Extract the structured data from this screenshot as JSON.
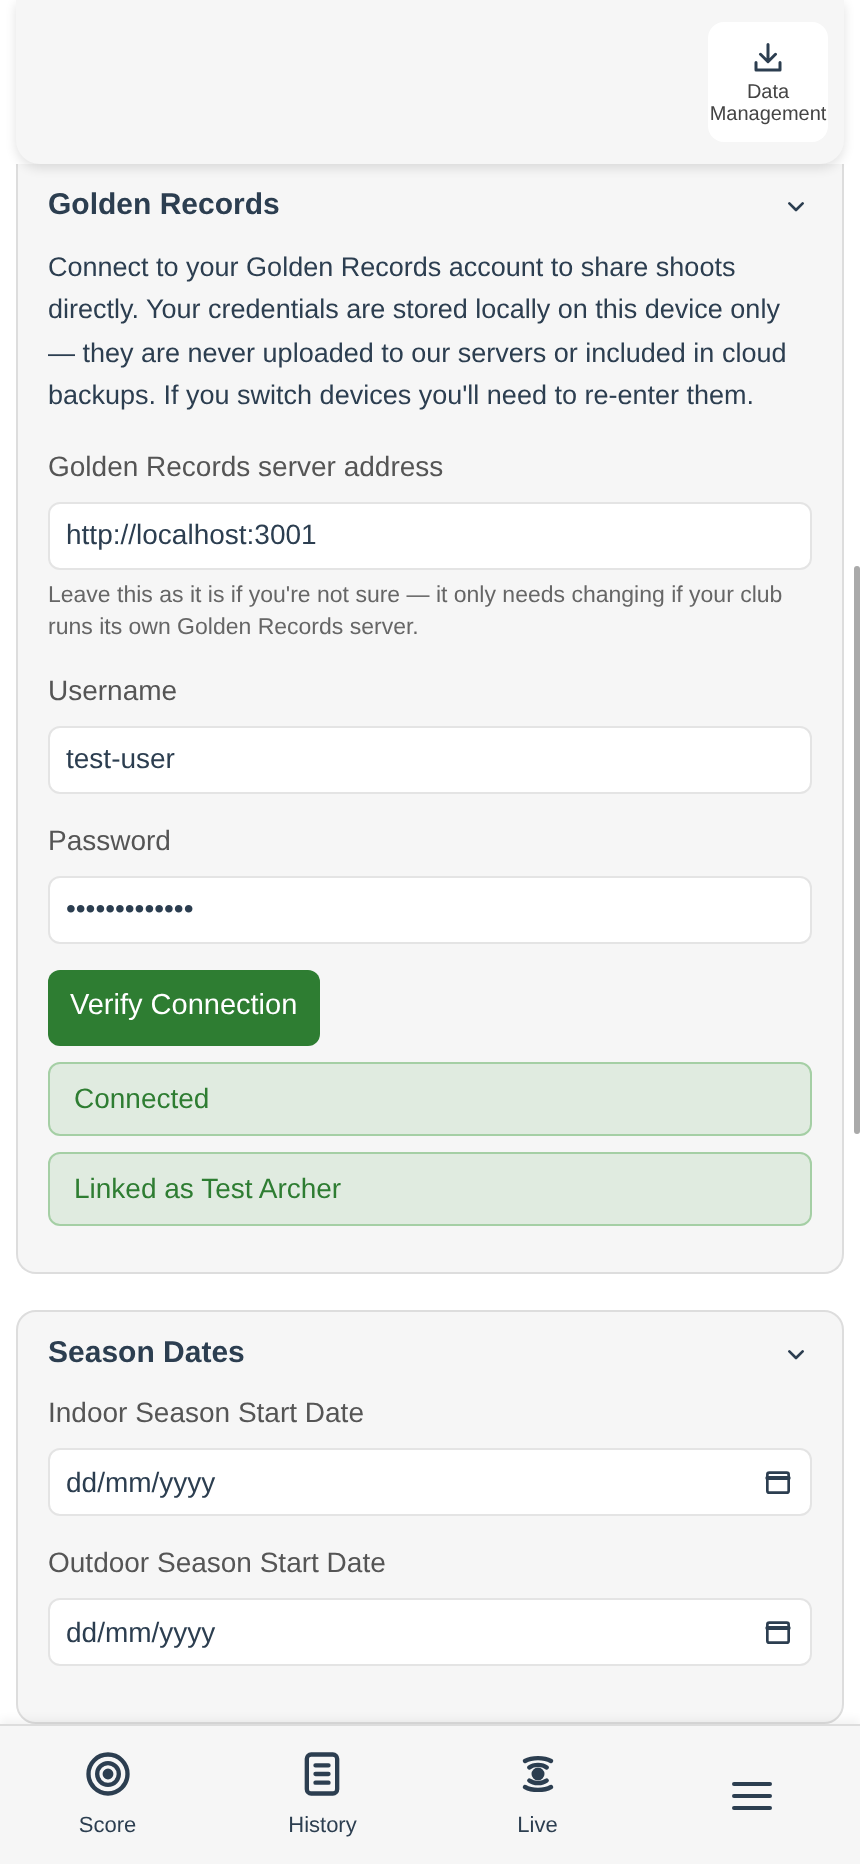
{
  "header": {
    "button": {
      "label": "Data Management"
    }
  },
  "sections": [
    {
      "title": "Golden Records",
      "expanded": true,
      "intro": "Connect to your Golden Records account to share shoots directly. Your credentials are stored locally on this device only — they are never uploaded to our servers or included in cloud backups. If you switch devices you'll need to re-enter them.",
      "fields": [
        {
          "kind": "text",
          "label": "Golden Records server address",
          "value": "http://localhost:3001",
          "help": "Leave this as it is if you're not sure — it only needs changing if your club runs its own Golden Records server."
        },
        {
          "kind": "text",
          "label": "Username",
          "value": "test-user"
        },
        {
          "kind": "password",
          "label": "Password",
          "value": "•••••••••••••"
        }
      ],
      "button": "Verify Connection",
      "alerts": [
        "Connected",
        "Linked as Test Archer"
      ]
    },
    {
      "title": "Season Dates",
      "expanded": true,
      "fields": [
        {
          "kind": "date",
          "label": "Indoor Season Start Date",
          "value": "dd/mm/yyyy"
        },
        {
          "kind": "date",
          "label": "Outdoor Season Start Date",
          "value": "dd/mm/yyyy"
        }
      ]
    }
  ],
  "nav": [
    {
      "kind": "score",
      "label": "Score"
    },
    {
      "kind": "history",
      "label": "History"
    },
    {
      "kind": "live",
      "label": "Live"
    },
    {
      "kind": "menu"
    }
  ]
}
